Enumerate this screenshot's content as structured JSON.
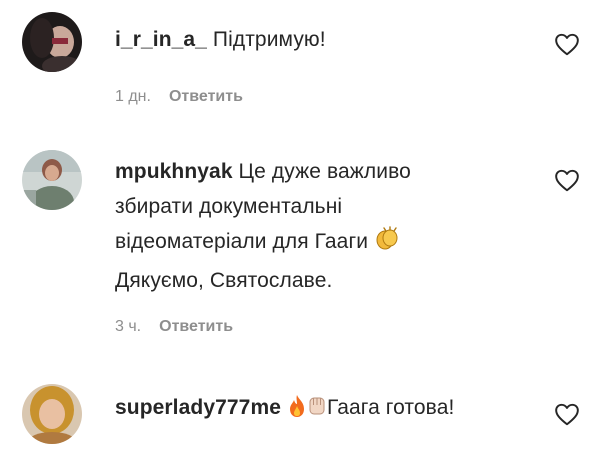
{
  "comments": [
    {
      "username": "i_r_in_a_",
      "text_lines": [
        "Підтримую!"
      ],
      "time": "1 дн.",
      "reply_label": "Ответить"
    },
    {
      "username": "mpukhnyak",
      "text_lines": [
        "Це дуже важливо",
        "збирати документальні",
        "відеоматеріали для Гааги",
        "Дякуємо, Святославе."
      ],
      "time": "3 ч.",
      "reply_label": "Ответить"
    },
    {
      "username": "superlady777me",
      "text_lines": [
        "Гаага готова!"
      ],
      "time": "",
      "reply_label": ""
    }
  ],
  "icons": {
    "like": "heart-outline-icon",
    "clap": "clapping-hands-emoji",
    "fire": "fire-emoji",
    "fist": "raised-fist-emoji"
  },
  "colors": {
    "text": "#262626",
    "meta": "#8e8e8e"
  }
}
